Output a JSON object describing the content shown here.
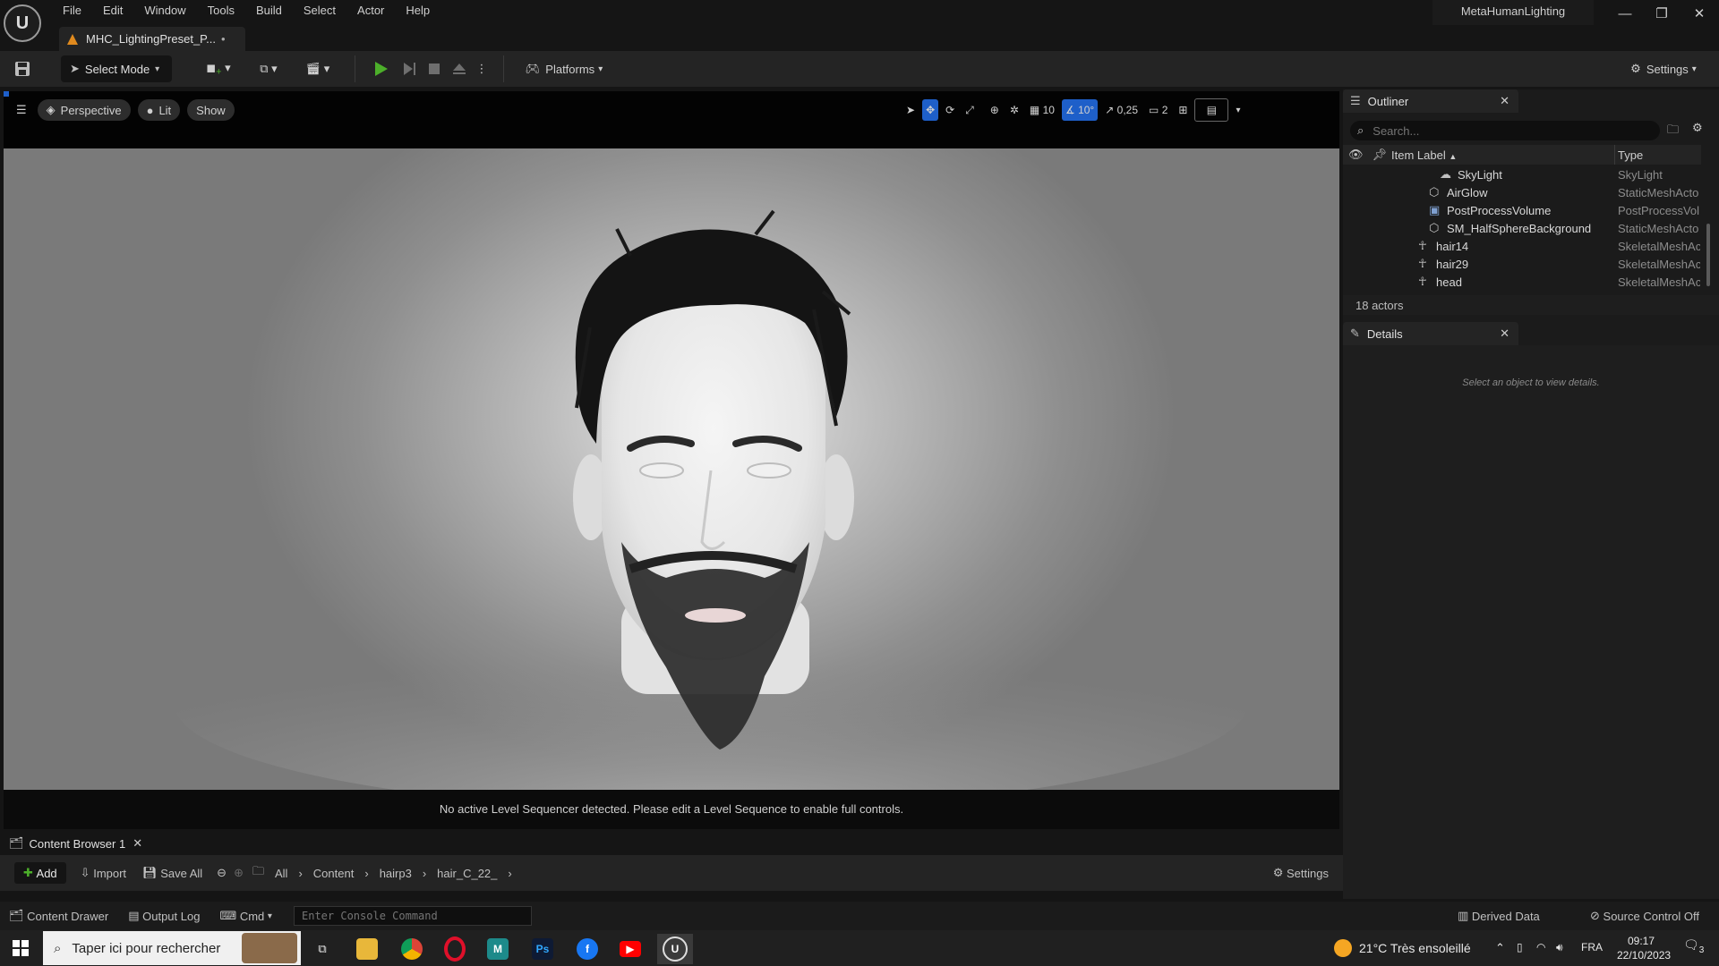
{
  "app": {
    "menu": [
      "File",
      "Edit",
      "Window",
      "Tools",
      "Build",
      "Select",
      "Actor",
      "Help"
    ],
    "document_tab": "MHC_LightingPreset_P...",
    "document_tab_modified": "•",
    "project_name": "MetaHumanLighting"
  },
  "toolbar": {
    "select_mode": "Select Mode",
    "platforms": "Platforms",
    "settings": "Settings"
  },
  "viewport": {
    "perspective": "Perspective",
    "lit": "Lit",
    "show": "Show",
    "grid_snap": "10",
    "rotation_snap": "10°",
    "scale_snap": "0,25",
    "camera_speed": "2",
    "sequencer_message": "No active Level Sequencer detected. Please edit a Level Sequence to enable full controls."
  },
  "outliner": {
    "title": "Outliner",
    "search_placeholder": "Search...",
    "col_label": "Item Label",
    "col_type": "Type",
    "rows": [
      {
        "label": "SkyLight",
        "type": "SkyLight"
      },
      {
        "label": "AirGlow",
        "type": "StaticMeshActo"
      },
      {
        "label": "PostProcessVolume",
        "type": "PostProcessVol"
      },
      {
        "label": "SM_HalfSphereBackground",
        "type": "StaticMeshActo"
      },
      {
        "label": "hair14",
        "type": "SkeletalMeshAc"
      },
      {
        "label": "hair29",
        "type": "SkeletalMeshAc"
      },
      {
        "label": "head",
        "type": "SkeletalMeshAc"
      }
    ],
    "actor_count": "18 actors"
  },
  "details": {
    "title": "Details",
    "empty_message": "Select an object to view details."
  },
  "content_browser": {
    "tab": "Content Browser 1",
    "add": "Add",
    "import": "Import",
    "save_all": "Save All",
    "breadcrumbs": [
      "All",
      "Content",
      "hairp3",
      "hair_C_22_"
    ],
    "settings": "Settings"
  },
  "status_bar": {
    "content_drawer": "Content Drawer",
    "output_log": "Output Log",
    "cmd": "Cmd",
    "console_placeholder": "Enter Console Command",
    "derived_data": "Derived Data",
    "source_control": "Source Control Off"
  },
  "taskbar": {
    "search_placeholder": "Taper ici pour rechercher",
    "weather": "21°C  Très ensoleillé",
    "language": "FRA",
    "time": "09:17",
    "date": "22/10/2023",
    "notifications": "3"
  },
  "colors": {
    "accent_blue": "#1e5fc9",
    "play_green": "#4caf2a",
    "panel_bg": "#242424"
  }
}
